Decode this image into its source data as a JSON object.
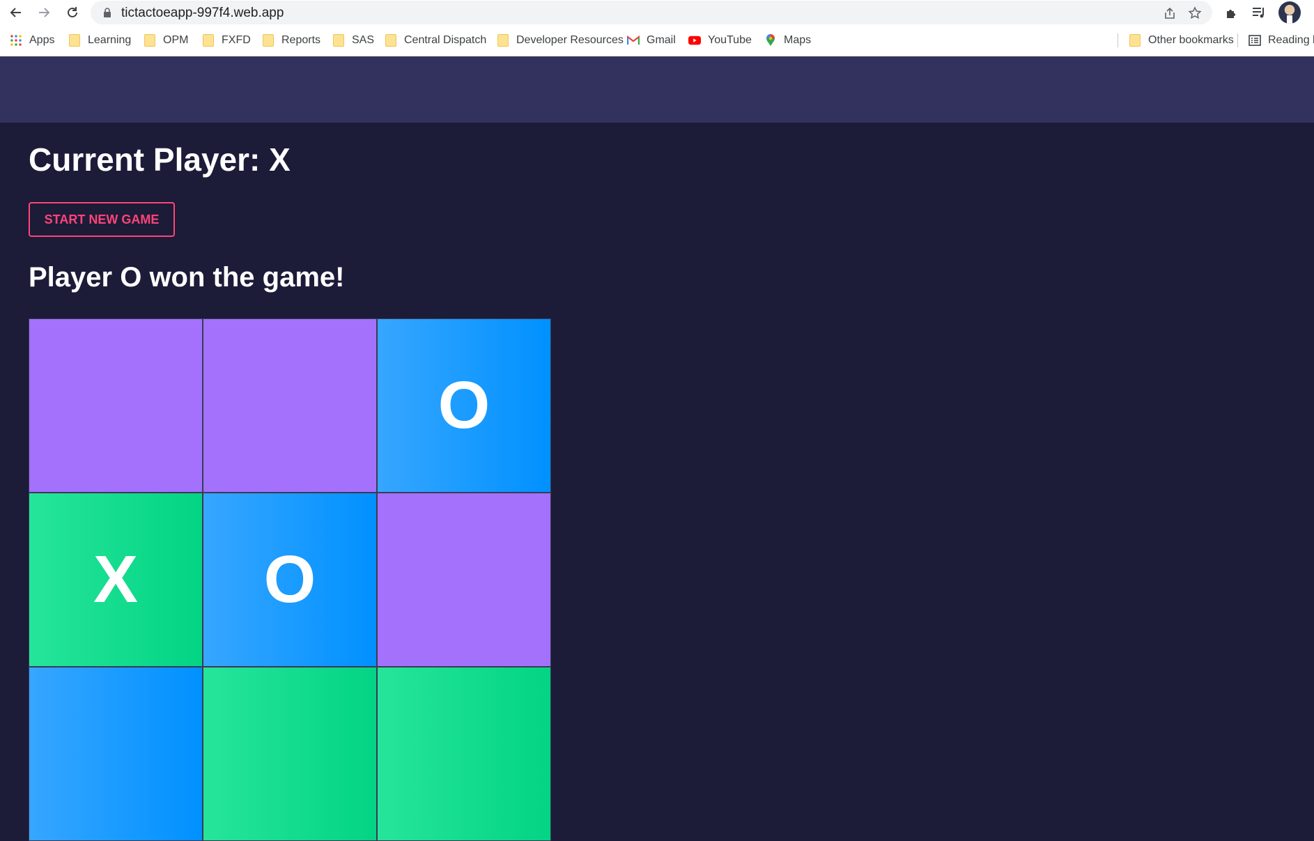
{
  "browser": {
    "url": "tictactoeapp-997f4.web.app",
    "bookmarks": [
      {
        "label": "Apps",
        "icon": "apps-grid-icon"
      },
      {
        "label": "Learning",
        "icon": "folder-icon"
      },
      {
        "label": "OPM",
        "icon": "folder-icon"
      },
      {
        "label": "FXFD",
        "icon": "folder-icon"
      },
      {
        "label": "Reports",
        "icon": "folder-icon"
      },
      {
        "label": "SAS",
        "icon": "folder-icon"
      },
      {
        "label": "Central Dispatch",
        "icon": "folder-icon"
      },
      {
        "label": "Developer Resources",
        "icon": "folder-icon"
      },
      {
        "label": "Gmail",
        "icon": "gmail-icon"
      },
      {
        "label": "YouTube",
        "icon": "youtube-icon"
      },
      {
        "label": "Maps",
        "icon": "maps-icon"
      }
    ],
    "other_bookmarks": "Other bookmarks",
    "reading_list": "Reading li"
  },
  "game": {
    "current_player_label": "Current Player: X",
    "new_game_label": "START NEW GAME",
    "status_message": "Player O won the game!",
    "cells": [
      {
        "value": "",
        "color": "purple"
      },
      {
        "value": "",
        "color": "purple"
      },
      {
        "value": "O",
        "color": "blue"
      },
      {
        "value": "X",
        "color": "green"
      },
      {
        "value": "O",
        "color": "blue"
      },
      {
        "value": "",
        "color": "purple"
      },
      {
        "value": "",
        "color": "blue"
      },
      {
        "value": "",
        "color": "green"
      },
      {
        "value": "",
        "color": "green"
      }
    ]
  },
  "colors": {
    "page_bg": "#1c1b38",
    "header_bg": "#33325e",
    "accent_pink": "#ff4477",
    "cell_purple": "#a371fb",
    "cell_blue": "#0091ff",
    "cell_green": "#03d484"
  }
}
